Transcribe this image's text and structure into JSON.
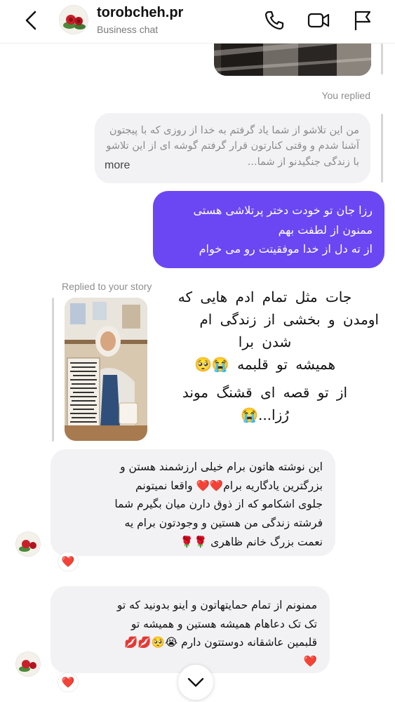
{
  "header": {
    "title": "torobcheh.pr",
    "subtitle": "Business chat"
  },
  "thread": {
    "you_replied_label": "You replied",
    "quoted_message": {
      "text": "من این تلاشو از شما یاد گرفتم به خدا  از روزی که با پیجتون آشنا شدم و وقتی کنارتون قرار گرفتم  گوشه ای از این تلاشو با زندگی جنگیدنو از شما...",
      "more_label": "more"
    },
    "sent_message": {
      "line1": "رزا جان تو خودت دختر پرتلاشی هستی",
      "line2": "ممنون از لطفت بهم",
      "line3": "از ته دل از خدا موفقیتت رو می خوام"
    },
    "replied_story_label": "Replied to your story",
    "story_caption": {
      "line1": "جات مثل تمام ادم هایی که",
      "line2": "اومدن و بخشی از زندگی ام",
      "line3": "شدن برا",
      "line4": "همیشه تو قلبمه 😭🥺",
      "line5": "از تو قصه ای قشنگ موند",
      "line6": "رُزا...😭"
    },
    "received_message_1": {
      "line1": "این نوشته هاتون  برام خیلی ارزشمند هستن و",
      "line2": "بزرگترین یادگاریه برام❤️❤️  واقعا  نمیتونم",
      "line3": "جلوی اشکامو که از ذوق دارن میان بگیرم  شما",
      "line4": "فرشته زندگی من هستین و وجودتون برام یه",
      "line5": "نعمت بزرگ  خانم ظاهری 🌹🌹",
      "reaction": "❤️"
    },
    "received_message_2": {
      "line1": "ممنونم از تمام حمایتهاتون و اینو بدونید که تو",
      "line2": "تک تک دعاهام همیشه هستین و همیشه تو",
      "line3": "قلبمین عاشقانه دوستتون دارم 😭🥺💋💋",
      "line4": "❤️",
      "reaction": "❤️"
    }
  },
  "icons": {
    "back": "chevron-left-icon",
    "call": "phone-icon",
    "video": "video-camera-icon",
    "report": "flag-icon",
    "scroll": "chevron-down-icon"
  },
  "colors": {
    "sent_bubble": "#6a47f3",
    "received_bubble": "#f2f2f4",
    "meta_text": "#8e8e8e"
  }
}
